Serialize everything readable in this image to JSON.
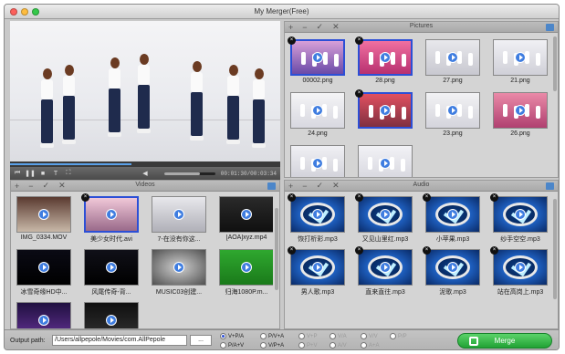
{
  "window": {
    "title": "My Merger(Free)"
  },
  "player": {
    "progress": 0.45,
    "volume": 0.7,
    "time_display": "00:01:30/00:03:34",
    "controls": [
      "previous",
      "pause",
      "stop",
      "text",
      "fullscreen",
      "volume"
    ]
  },
  "pictures": {
    "title": "Pictures",
    "items": [
      {
        "label": "00002.png",
        "selected": true
      },
      {
        "label": "28.png",
        "selected": true
      },
      {
        "label": "27.png",
        "selected": false
      },
      {
        "label": "21.png",
        "selected": false
      },
      {
        "label": "24.png",
        "selected": false
      },
      {
        "label": "",
        "selected": true
      },
      {
        "label": "23.png",
        "selected": false
      },
      {
        "label": "26.png",
        "selected": false
      },
      {
        "label": "",
        "selected": false
      },
      {
        "label": "",
        "selected": false
      }
    ]
  },
  "videos": {
    "title": "Videos",
    "items": [
      {
        "label": "IMG_0334.MOV",
        "selected": false
      },
      {
        "label": "美少女时代.avi",
        "selected": true
      },
      {
        "label": "7-在没有你这...",
        "selected": false
      },
      {
        "label": "[AOA]xyz.mp4",
        "selected": false
      },
      {
        "label": "冰雪奇缘HD中...",
        "selected": false
      },
      {
        "label": "风尾传奇-背...",
        "selected": false
      },
      {
        "label": "MUSIC03创建...",
        "selected": false
      },
      {
        "label": "归海1080P.m...",
        "selected": false
      },
      {
        "label": "",
        "selected": false
      },
      {
        "label": "",
        "selected": false
      }
    ]
  },
  "audio": {
    "title": "Audio",
    "items": [
      {
        "label": "恢打析彩.mp3"
      },
      {
        "label": "又见山里红.mp3"
      },
      {
        "label": "小苹果.mp3"
      },
      {
        "label": "纱手空空.mp3"
      },
      {
        "label": "男人歌.mp3"
      },
      {
        "label": "直来直往.mp3"
      },
      {
        "label": "泥歌.mp3"
      },
      {
        "label": "站在高岗上.mp3"
      }
    ]
  },
  "bottom": {
    "output_label": "Output path:",
    "output_path": "/Users/allpepole/Movies/com.AllPepole",
    "browse_label": "...",
    "options": [
      {
        "label": "V+P/A",
        "checked": true,
        "disabled": false
      },
      {
        "label": "P/V+A",
        "checked": false,
        "disabled": false
      },
      {
        "label": "V+P",
        "checked": false,
        "disabled": true
      },
      {
        "label": "V/A",
        "checked": false,
        "disabled": true
      },
      {
        "label": "V/V",
        "checked": false,
        "disabled": true
      },
      {
        "label": "P/P",
        "checked": false,
        "disabled": true
      },
      {
        "label": "P/A+V",
        "checked": false,
        "disabled": false
      },
      {
        "label": "V/P+A",
        "checked": false,
        "disabled": false
      },
      {
        "label": "P+V",
        "checked": false,
        "disabled": true
      },
      {
        "label": "A/V",
        "checked": false,
        "disabled": true
      },
      {
        "label": "A+A",
        "checked": false,
        "disabled": true
      }
    ],
    "merge_label": "Merge"
  },
  "colors": {
    "accent": "#2c4fd6",
    "merge": "#21a234",
    "play": "#3f7de0"
  }
}
